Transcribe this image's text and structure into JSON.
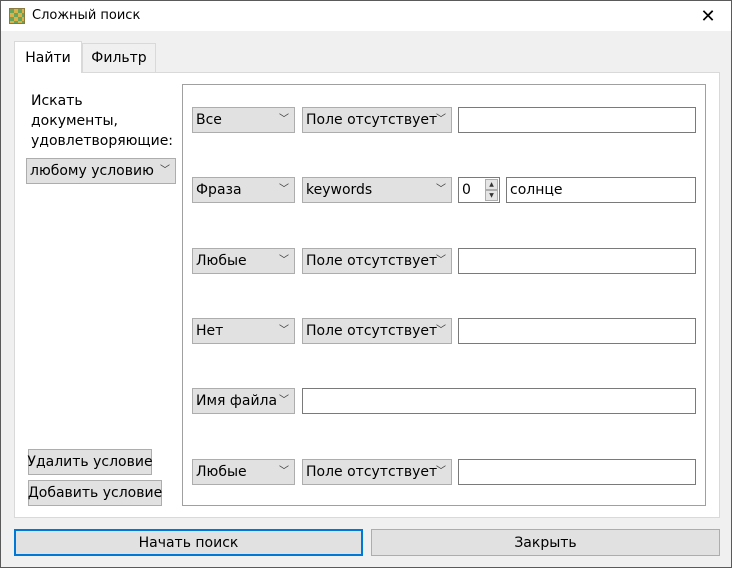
{
  "window": {
    "title": "Сложный поиск",
    "close_glyph": "✕"
  },
  "tabs": [
    {
      "label": "Найти",
      "active": true
    },
    {
      "label": "Фильтр",
      "active": false
    }
  ],
  "find": {
    "prompt_line1": "Искать",
    "prompt_line2": "документы,",
    "prompt_line3": "удовлетворяющие:",
    "match_mode": "любому условию",
    "delete_condition": "Удалить условие",
    "add_condition": "Добавить условие"
  },
  "conditions": [
    {
      "type": "Все",
      "field": "Поле отсутствует",
      "value": ""
    },
    {
      "type": "Фраза",
      "field": "keywords",
      "spin": "0",
      "value": "солнце"
    },
    {
      "type": "Любые",
      "field": "Поле отсутствует",
      "value": ""
    },
    {
      "type": "Нет",
      "field": "Поле отсутствует",
      "value": ""
    },
    {
      "type": "Имя файла",
      "value": ""
    },
    {
      "type": "Любые",
      "field": "Поле отсутствует",
      "value": ""
    }
  ],
  "footer": {
    "start_search": "Начать поиск",
    "close": "Закрыть"
  },
  "icons": {
    "dropdown": "chevron-down-icon",
    "spin_up": "▲",
    "spin_down": "▼",
    "arrow_glyph": "﹀"
  }
}
